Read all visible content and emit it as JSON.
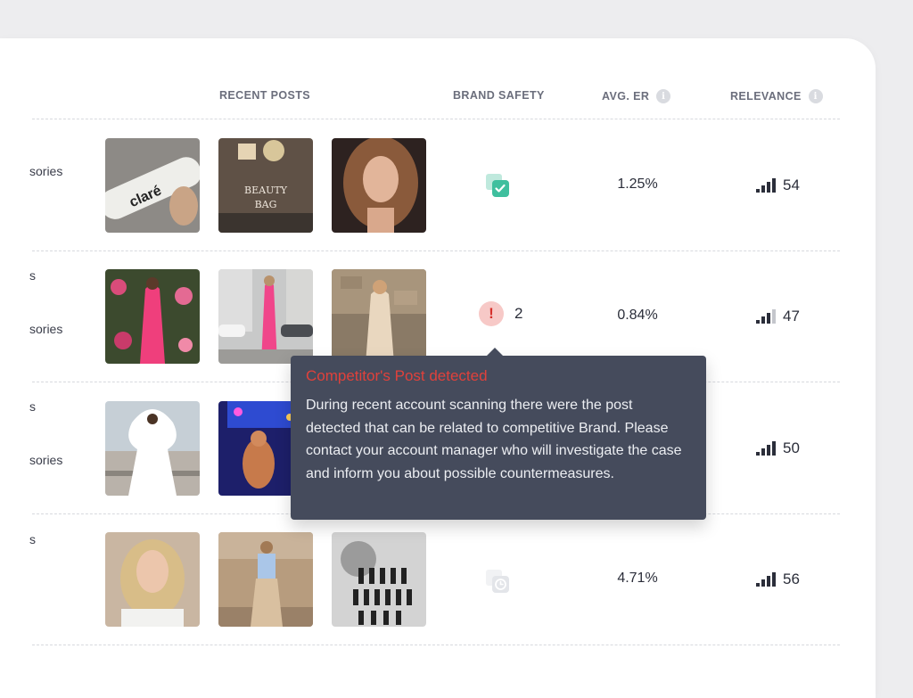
{
  "columns": {
    "recent_posts": "RECENT POSTS",
    "brand_safety": "BRAND SAFETY",
    "avg_er": "AVG. ER",
    "relevance": "RELEVANCE",
    "info_glyph": "i"
  },
  "rows": [
    {
      "category_lines": [
        "sories"
      ],
      "safety": "safe",
      "avg_er": "1.25%",
      "relevance": "54",
      "relevance_level": 4
    },
    {
      "category_lines": [
        "s",
        "sories"
      ],
      "safety": "alert",
      "alert_count": "2",
      "avg_er": "0.84%",
      "relevance": "47",
      "relevance_level": 3
    },
    {
      "category_lines": [
        "s",
        "sories"
      ],
      "safety": "hidden",
      "avg_er": "",
      "relevance": "50",
      "relevance_level": 4
    },
    {
      "category_lines": [
        "s"
      ],
      "safety": "pending",
      "avg_er": "4.71%",
      "relevance": "56",
      "relevance_level": 4
    }
  ],
  "thumb_texts": {
    "brand": "claré",
    "beauty": "BEAUTY",
    "bag": "BAG"
  },
  "alert_glyph": "!",
  "tooltip": {
    "title": "Competitor's Post detected",
    "body": "During recent account scanning there were the post detected that can be related to competitive Brand. Please contact your account manager who will investigate the case and inform you about possible countermeasures."
  },
  "colors": {
    "safe": "#3fbf9e",
    "alert": "#d6302b",
    "tooltip_bg": "#454b5c"
  }
}
